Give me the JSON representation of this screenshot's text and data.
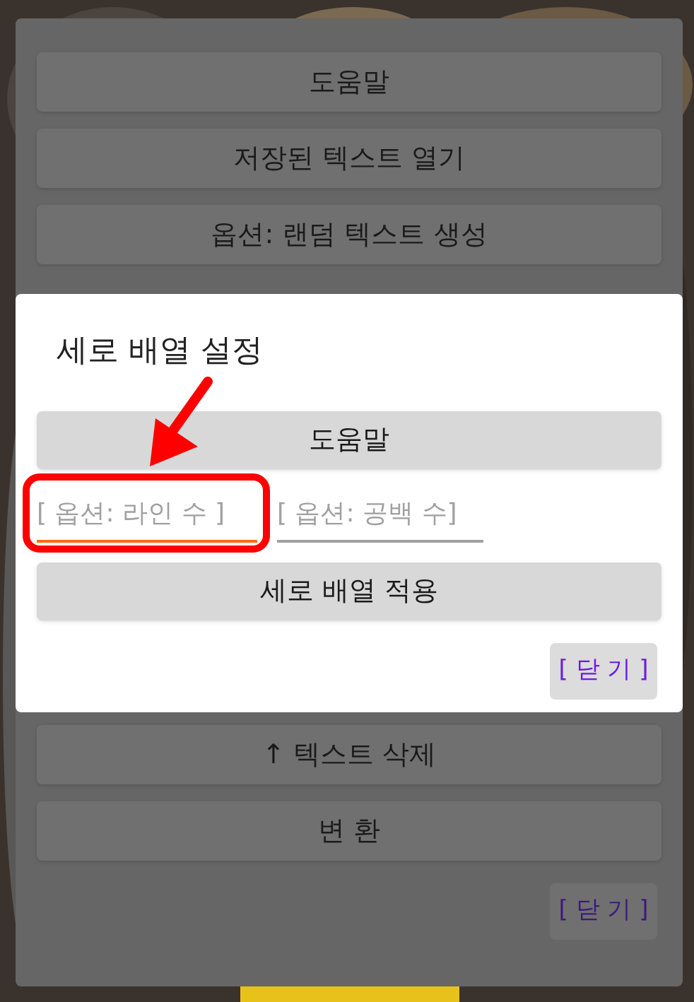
{
  "background_menu": {
    "buttons": [
      "도움말",
      "저장된 텍스트 열기",
      "옵션: 랜덤 텍스트 생성"
    ],
    "lower_buttons": [
      "↑ 텍스트 삭제",
      "변 환"
    ],
    "close_button": "[ 닫 기 ]"
  },
  "dialog": {
    "title": "세로 배열 설정",
    "help_button": "도움말",
    "inputs": [
      {
        "placeholder": "[ 옵션: 라인 수 ]",
        "focused": true
      },
      {
        "placeholder": "[ 옵션: 공백 수]",
        "focused": false
      }
    ],
    "apply_button": "세로 배열 적용",
    "close_button": "[ 닫 기 ]"
  }
}
